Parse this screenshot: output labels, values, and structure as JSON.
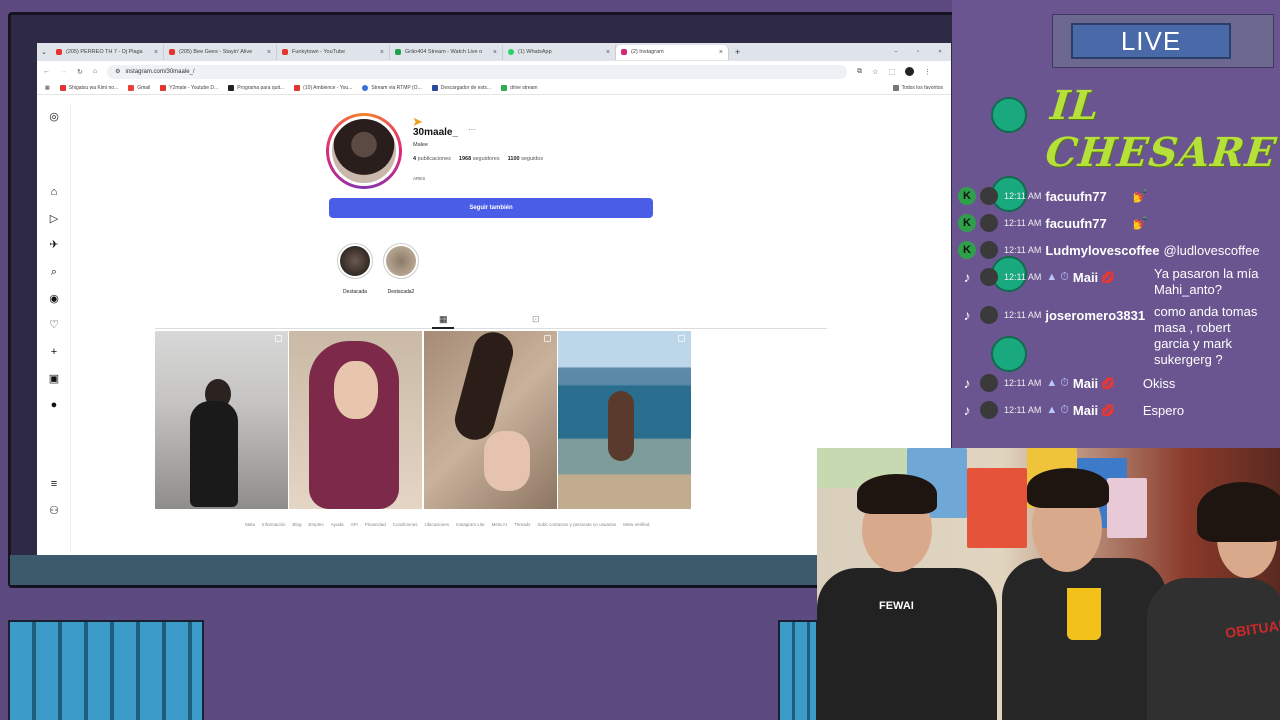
{
  "browser": {
    "tabs": [
      {
        "label": "(205) PERREO TH 7 - Dj Plaga",
        "color": "#e5342d"
      },
      {
        "label": "(205) Bee Gees - Stayin' Alive",
        "color": "#e5342d"
      },
      {
        "label": "Funkytown - YouTube",
        "color": "#e5342d"
      },
      {
        "label": "Grão404 Stream - Watch Live o",
        "color": "#22a04a"
      },
      {
        "label": "(1) WhatsApp",
        "color": "#25d366"
      },
      {
        "label": "(2) Instagram",
        "color": "#d6287a"
      }
    ],
    "url": "instagram.com/30maale_/",
    "bookmarks": [
      {
        "label": "Shigatsu wa Kimi no...",
        "color": "#e5342d"
      },
      {
        "label": "Gmail",
        "color": "#ea4335"
      },
      {
        "label": "Y2mate - Youtube D...",
        "color": "#e5342d"
      },
      {
        "label": "Programa para quit...",
        "color": "#222222"
      },
      {
        "label": "(10) Ambience - You...",
        "color": "#e5342d"
      },
      {
        "label": "Stream via RTMP (O...",
        "color": "#3b6fd8"
      },
      {
        "label": "Descargador de ests...",
        "color": "#2a4aa0"
      },
      {
        "label": "drive stream",
        "color": "#34a853"
      }
    ],
    "all_bookmarks": "Todos los favoritos"
  },
  "profile": {
    "username": "30maale_",
    "more": "···",
    "fullname": "Malee",
    "posts_count": "4",
    "posts_label": "publicaciones",
    "followers_count": "1968",
    "followers_label": "seguidores",
    "following_count": "1100",
    "following_label": "seguidos",
    "bio": "ARES",
    "follow_button": "Seguir también",
    "highlights": [
      {
        "label": "Destacada"
      },
      {
        "label": "Destacada2"
      }
    ]
  },
  "footer_links": [
    "Meta",
    "Información",
    "Blog",
    "Empleo",
    "Ayuda",
    "API",
    "Privacidad",
    "Condiciones",
    "Ubicaciones",
    "Instagram Lite",
    "Meta AI",
    "Threads",
    "Subir contactos y personas no usuarias",
    "Meta Verified"
  ],
  "overlay": {
    "live_label": "LIVE",
    "logo_text": "IL CHESARE",
    "colors": {
      "live_bg": "#4a69a8",
      "logo": "#b6e03a",
      "kick": "#2ea04a"
    }
  },
  "chat": [
    {
      "platform": "kick-icon",
      "time": "12:11 AM",
      "user": "facuufn77",
      "msg": "💅",
      "badges": ""
    },
    {
      "platform": "kick-icon",
      "time": "12:11 AM",
      "user": "facuufn77",
      "msg": "💅",
      "badges": ""
    },
    {
      "platform": "kick-icon",
      "time": "12:11 AM",
      "user": "Ludmylovescoffee",
      "msg": "@ludlovescoffee",
      "badges": ""
    },
    {
      "platform": "tiktok-icon",
      "time": "12:11 AM",
      "user": "Maii",
      "msg": "Ya pasaron la mía",
      "msg2": "Mahi_anto?",
      "badges": "▲ ⏱ ",
      "tail": "💋"
    },
    {
      "platform": "tiktok-icon",
      "time": "12:11 AM",
      "user": "joseromero3831",
      "msg": "como anda tomas",
      "msg2": "masa , robert",
      "msg3": "garcia y mark",
      "msg4": "sukergerg ?",
      "badges": ""
    },
    {
      "platform": "tiktok-icon",
      "time": "12:11 AM",
      "user": "Maii",
      "msg": "Okiss",
      "badges": "▲ ⏱ ",
      "tail": "💋"
    },
    {
      "platform": "tiktok-icon",
      "time": "12:11 AM",
      "user": "Maii",
      "msg": "Espero",
      "badges": "▲ ⏱ ",
      "tail": "💋"
    }
  ],
  "webcam": {
    "shirt_text": "FEWAI",
    "shirt_print": "OBITUARY"
  }
}
